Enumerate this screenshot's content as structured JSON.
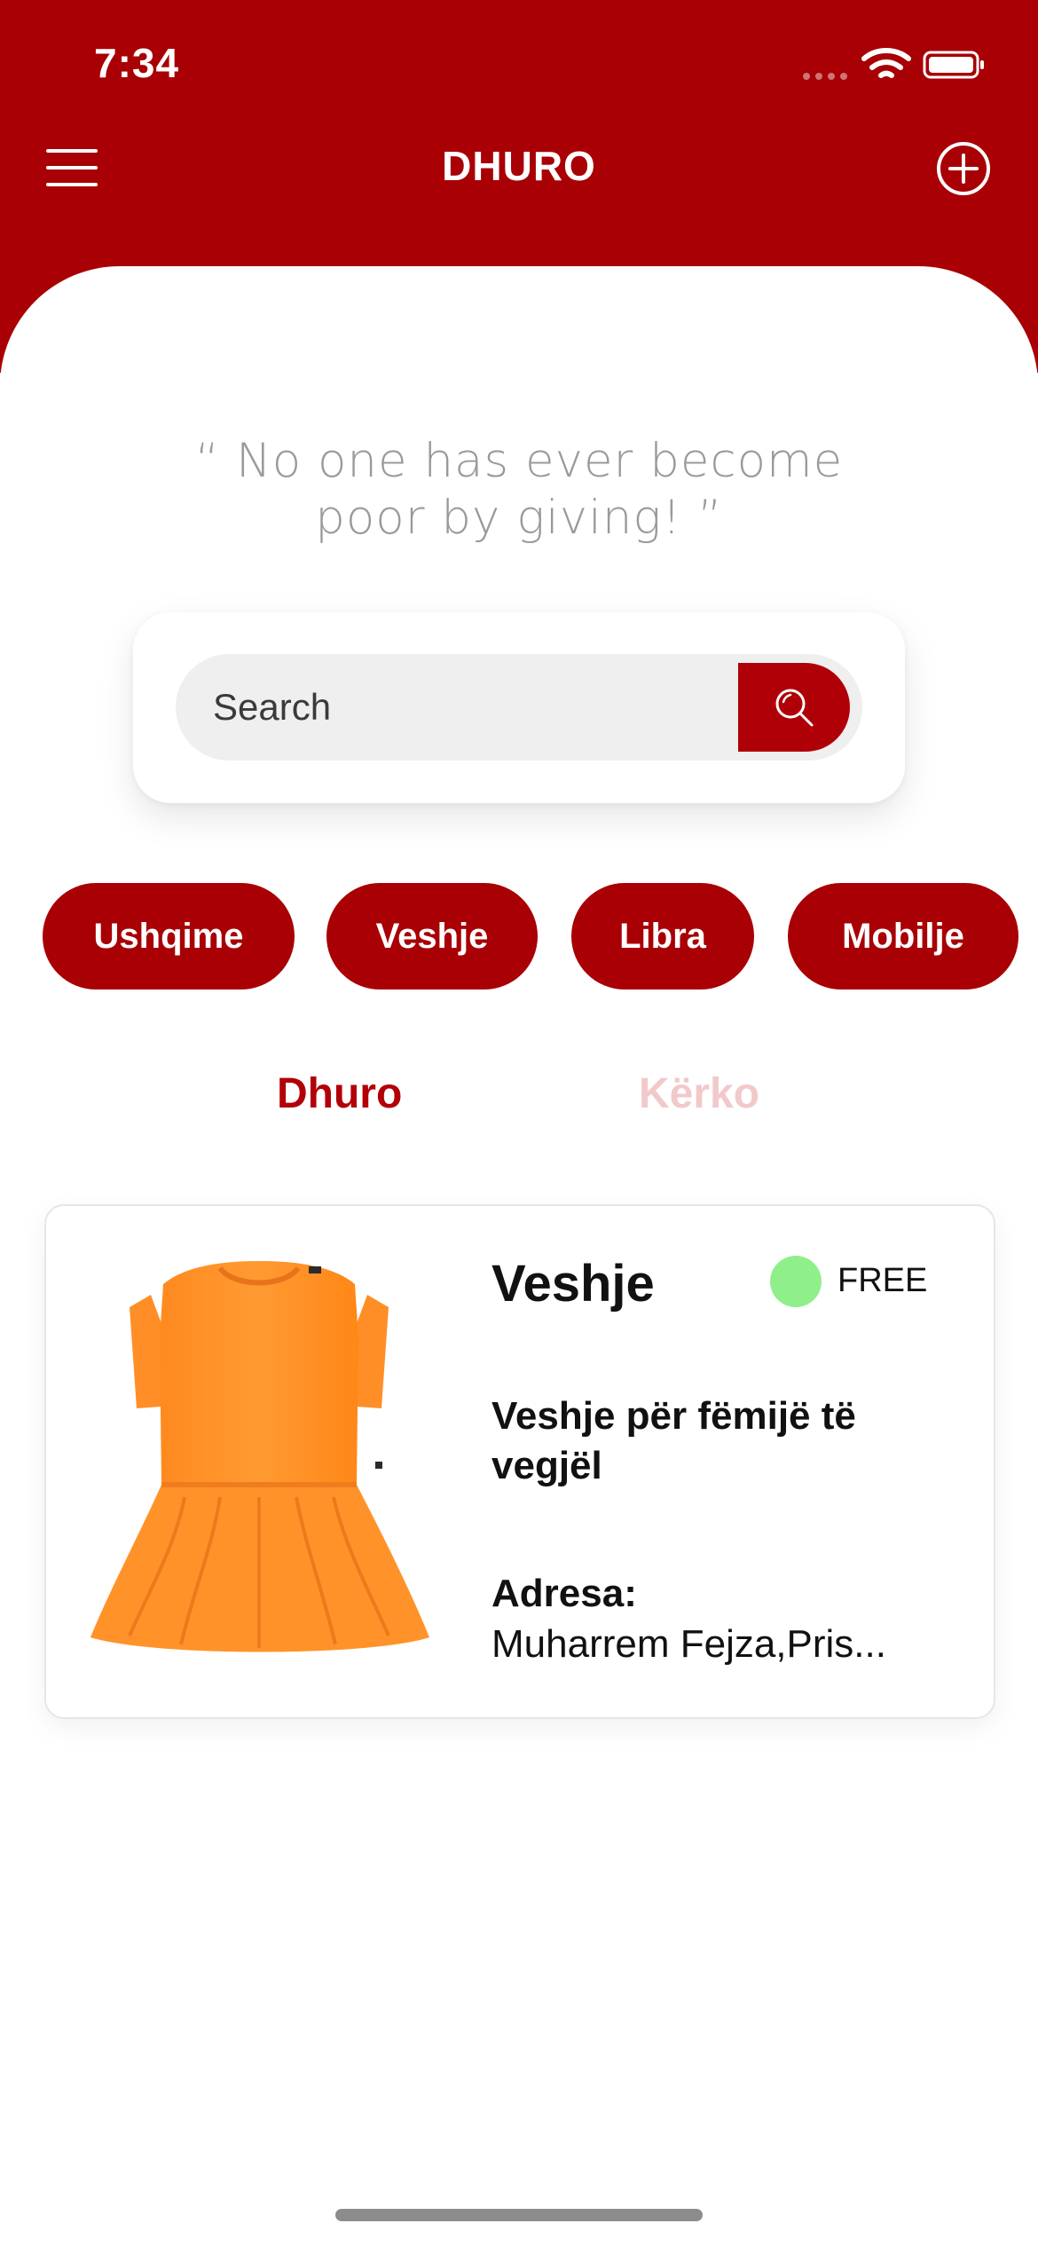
{
  "status_bar": {
    "time": "7:34"
  },
  "header": {
    "title": "DHURO"
  },
  "quote": {
    "text": "“ No one has ever become poor by giving! ”"
  },
  "search": {
    "placeholder": "Search"
  },
  "categories": [
    {
      "label": "Ushqime"
    },
    {
      "label": "Veshje"
    },
    {
      "label": "Libra"
    },
    {
      "label": "Mobilje"
    }
  ],
  "tabs": [
    {
      "label": "Dhuro",
      "active": true
    },
    {
      "label": "Kërko",
      "active": false
    }
  ],
  "listing": {
    "title": "Veshje",
    "status": "FREE",
    "status_color": "#8ff08b",
    "description": "Veshje për fëmijë të vegjël",
    "address_label": "Adresa:",
    "address_value": "Muharrem Fejza,Pris..."
  },
  "colors": {
    "brand": "#a80004",
    "inactive_tab": "#f2c9ca",
    "quote_text": "#9a9a9a"
  }
}
